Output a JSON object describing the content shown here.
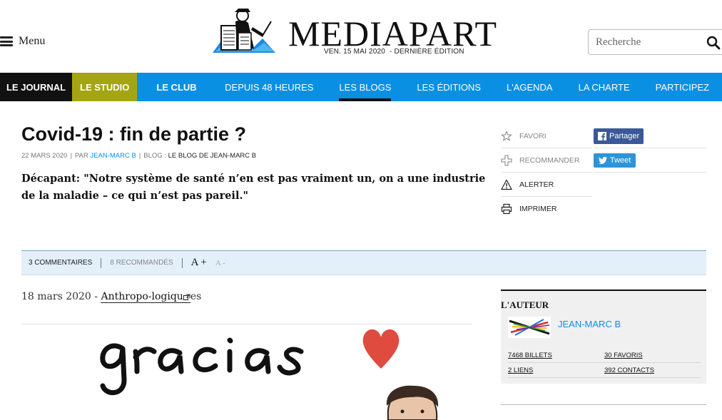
{
  "header": {
    "menu_label": "Menu",
    "logo_text": "MEDIAPART",
    "edition": "VEN. 15 MAI 2020  - DERNIÈRE ÉDITION",
    "search_placeholder": "Recherche"
  },
  "nav": {
    "items": [
      {
        "label": "LE JOURNAL"
      },
      {
        "label": "LE STUDIO"
      },
      {
        "label": "LE CLUB"
      },
      {
        "label": "DEPUIS 48 HEURES"
      },
      {
        "label": "LES BLOGS"
      },
      {
        "label": "LES ÉDITIONS"
      },
      {
        "label": "L'AGENDA"
      },
      {
        "label": "LA CHARTE"
      },
      {
        "label": "PARTICIPEZ"
      }
    ],
    "active": "LES BLOGS"
  },
  "article": {
    "title": "Covid-19 : fin de partie ?",
    "date": "22 MARS 2020",
    "by_prefix": "PAR",
    "author": "JEAN-MARC B",
    "blog_prefix": "BLOG :",
    "blog_name": "LE BLOG DE JEAN-MARC B",
    "lede": "Décapant: \"Notre système de santé n’en est pas vraiment un, on a une industrie de la maladie – ce qui n’est pas pareil.\""
  },
  "actions": {
    "favori": "FAVORI",
    "recommander": "RECOMMANDER",
    "alerter": "ALERTER",
    "imprimer": "IMPRIMER",
    "partager": "Partager",
    "tweet": "Tweet"
  },
  "toolbar": {
    "comments": "3 COMMENTAIRES",
    "recommended": "8 RECOMMANDÉS",
    "font_up": "A +",
    "font_down": "A -"
  },
  "body": {
    "date": "18 mars 2020 -",
    "link": "Anthropo-logiqu",
    "link_tail": "es"
  },
  "image": {
    "lettering": "gracias"
  },
  "author_box": {
    "heading": "L'AUTEUR",
    "name": "JEAN-MARC B",
    "billets": "7468 BILLETS",
    "favoris": "30 FAVORIS",
    "liens": "2 LIENS",
    "contacts": "392 CONTACTS"
  },
  "colors": {
    "nav_blue": "#0a90e3",
    "journal_black": "#111111",
    "studio_olive": "#a4a512",
    "toolbar_bg": "#e3eff9",
    "facebook": "#3b5998",
    "twitter": "#2c95d8"
  }
}
